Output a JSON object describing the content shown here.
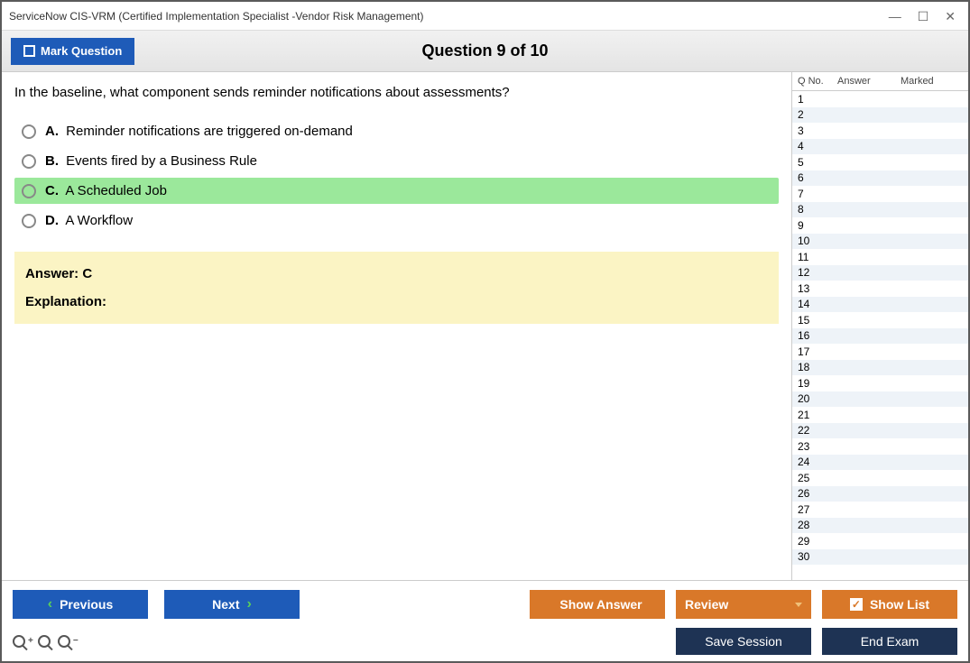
{
  "window": {
    "title": "ServiceNow CIS-VRM (Certified Implementation Specialist -Vendor Risk Management)"
  },
  "toolbar": {
    "mark_question_label": "Mark Question",
    "question_title": "Question 9 of 10"
  },
  "question": {
    "text": "In the baseline, what component sends reminder notifications about assessments?",
    "options": [
      {
        "letter": "A.",
        "text": "Reminder notifications are triggered on-demand",
        "correct": false
      },
      {
        "letter": "B.",
        "text": "Events fired by a Business Rule",
        "correct": false
      },
      {
        "letter": "C.",
        "text": "A Scheduled Job",
        "correct": true
      },
      {
        "letter": "D.",
        "text": "A Workflow",
        "correct": false
      }
    ]
  },
  "answer_box": {
    "answer_line": "Answer: C",
    "explanation_label": "Explanation:"
  },
  "sidebar": {
    "headers": {
      "qno": "Q No.",
      "answer": "Answer",
      "marked": "Marked"
    },
    "row_count": 30
  },
  "footer": {
    "previous": "Previous",
    "next": "Next",
    "show_answer": "Show Answer",
    "review": "Review",
    "show_list": "Show List",
    "save_session": "Save Session",
    "end_exam": "End Exam"
  }
}
